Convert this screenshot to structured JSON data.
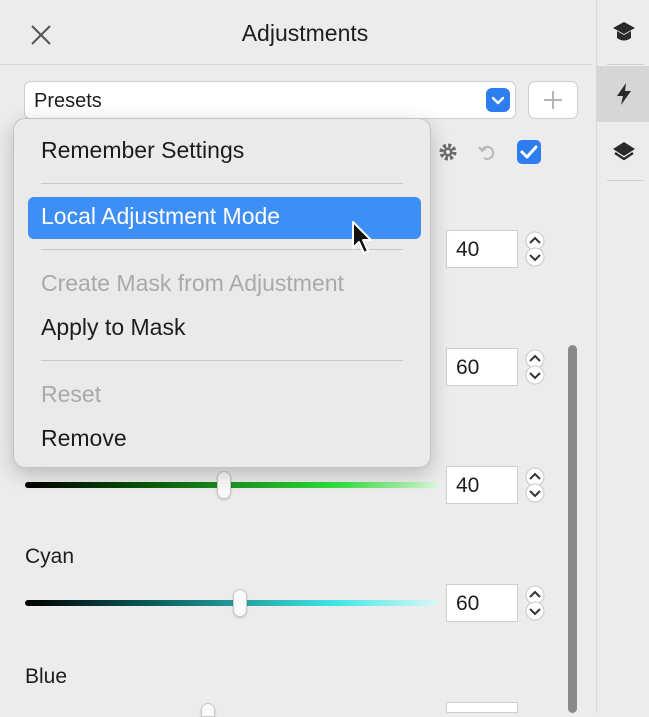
{
  "header": {
    "title": "Adjustments"
  },
  "presets": {
    "label": "Presets"
  },
  "context_menu": {
    "items": [
      {
        "label": "Remember Settings",
        "state": "enabled"
      },
      {
        "label": "Local Adjustment Mode",
        "state": "highlighted"
      },
      {
        "label": "Create Mask from Adjustment",
        "state": "disabled"
      },
      {
        "label": "Apply to Mask",
        "state": "enabled"
      },
      {
        "label": "Reset",
        "state": "disabled"
      },
      {
        "label": "Remove",
        "state": "enabled"
      }
    ]
  },
  "sliders": [
    {
      "value": "40"
    },
    {
      "value": "60"
    },
    {
      "value": "40",
      "color": "#2ee03a"
    },
    {
      "label": "Cyan",
      "value": "60",
      "color": "#3fe6e6"
    },
    {
      "label": "Blue"
    }
  ],
  "colors": {
    "accent": "#2d7df0",
    "highlight": "#3d8ef5"
  },
  "icons": [
    "close-icon",
    "chevron-down-icon",
    "plus-icon",
    "gear-icon",
    "undo-icon",
    "checkbox-checked-icon",
    "graduation-cap-icon",
    "lightning-icon",
    "layers-icon"
  ]
}
